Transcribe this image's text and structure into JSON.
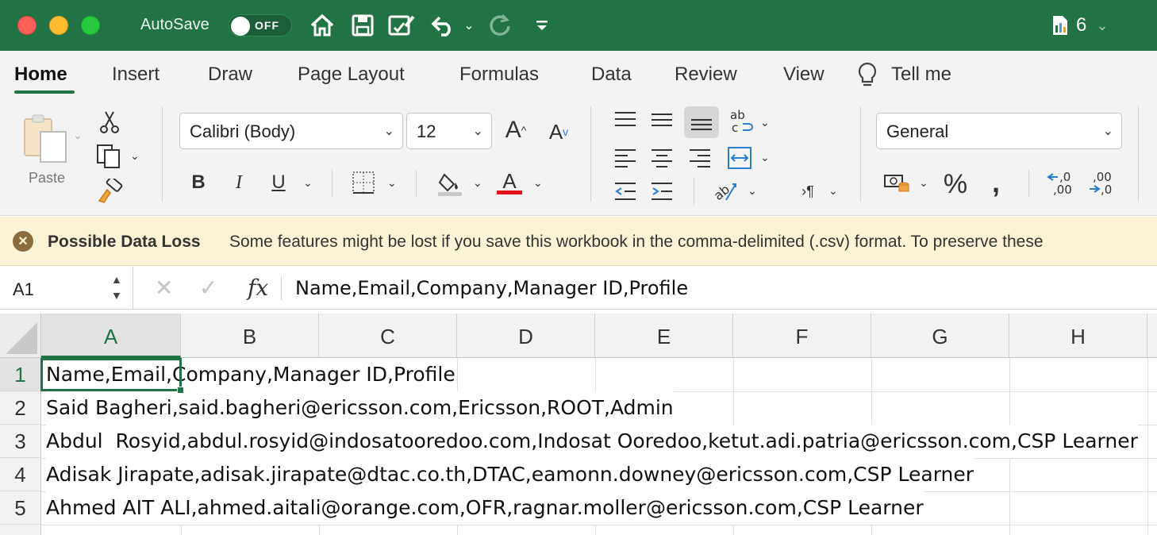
{
  "titlebar": {
    "autosave_label": "AutoSave",
    "autosave_state": "OFF",
    "doc_count": "6",
    "icons": [
      "home-icon",
      "save-icon",
      "edit-document-icon",
      "undo-icon",
      "redo-icon",
      "customize-toolbar-icon",
      "document-icon"
    ]
  },
  "tabs": [
    {
      "label": "Home",
      "active": true
    },
    {
      "label": "Insert"
    },
    {
      "label": "Draw"
    },
    {
      "label": "Page Layout"
    },
    {
      "label": "Formulas"
    },
    {
      "label": "Data"
    },
    {
      "label": "Review"
    },
    {
      "label": "View"
    },
    {
      "label": "Tell me"
    }
  ],
  "ribbon": {
    "paste_label": "Paste",
    "font_name": "Calibri (Body)",
    "font_size": "12",
    "bold": "B",
    "italic": "I",
    "underline": "U",
    "number_format": "General",
    "font_color": "#e8141c"
  },
  "message": {
    "title": "Possible Data Loss",
    "text": "Some features might be lost if you save this workbook in the comma-delimited (.csv) format. To preserve these"
  },
  "formula_bar": {
    "name_box": "A1",
    "fx": "fx",
    "content": "Name,Email,Company,Manager ID,Profile"
  },
  "grid": {
    "columns": [
      "A",
      "B",
      "C",
      "D",
      "E",
      "F",
      "G",
      "H"
    ],
    "rows": [
      {
        "num": "1",
        "value": "Name,Email,Company,Manager ID,Profile"
      },
      {
        "num": "2",
        "value": "Said Bagheri,said.bagheri@ericsson.com,Ericsson,ROOT,Admin"
      },
      {
        "num": "3",
        "value": "Abdul  Rosyid,abdul.rosyid@indosatooredoo.com,Indosat Ooredoo,ketut.adi.patria@ericsson.com,CSP Learner"
      },
      {
        "num": "4",
        "value": "Adisak Jirapate,adisak.jirapate@dtac.co.th,DTAC,eamonn.downey@ericsson.com,CSP Learner"
      },
      {
        "num": "5",
        "value": "Ahmed AIT ALI,ahmed.aitali@orange.com,OFR,ragnar.moller@ericsson.com,CSP Learner"
      }
    ]
  },
  "colors": {
    "brand": "#217346",
    "message_bg": "#fcf3d7"
  }
}
